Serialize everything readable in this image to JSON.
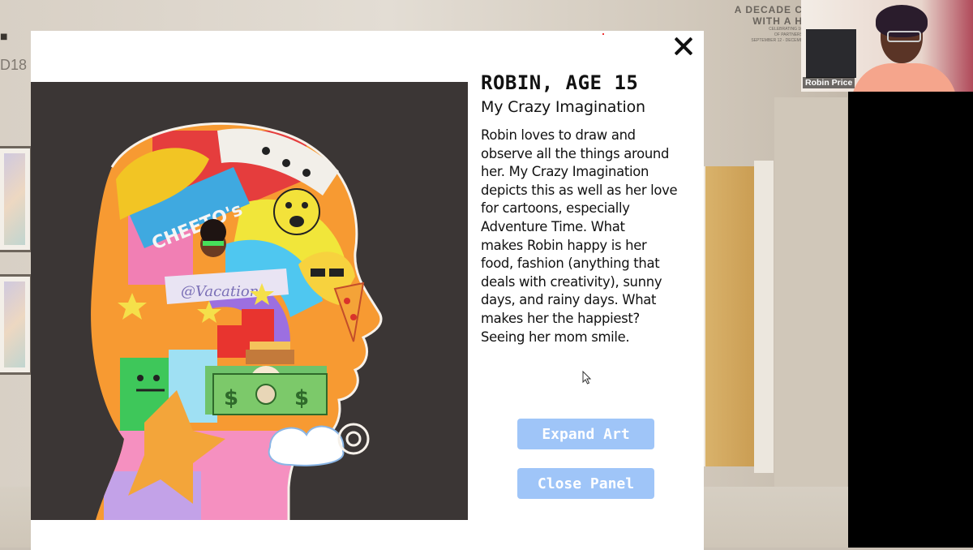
{
  "background": {
    "sign_line1": "A DECADE C",
    "sign_line2": "WITH A H",
    "sign_small1": "CELEBRATING 10",
    "sign_small2": "OF PARTNERS",
    "sign_small3": "SEPTEMBER 12 - DECEMB",
    "left_text": "D18"
  },
  "modal": {
    "artist_heading": "ROBIN, AGE 15",
    "art_title": "My Crazy Imagination",
    "description_lines": [
      "Robin loves to draw and",
      "observe all the things around",
      "her. My Crazy Imagination",
      "depicts this as well as her love",
      "for cartoons, especially",
      "Adventure Time. What",
      "makes Robin happy is her",
      "food, fashion (anything that",
      "deals with creativity), sunny",
      "days, and rainy days. What",
      "makes her the happiest?",
      "Seeing her mom smile."
    ],
    "expand_label": "Expand Art",
    "close_label": "Close Panel",
    "artwork_text": {
      "cheetos": "CHEETO's",
      "banner": "@Vacation"
    }
  },
  "video_call": {
    "participant_name": "Robin Price"
  },
  "colors": {
    "button_bg": "#9fc5f8",
    "artwork_bg": "#3b3635"
  }
}
